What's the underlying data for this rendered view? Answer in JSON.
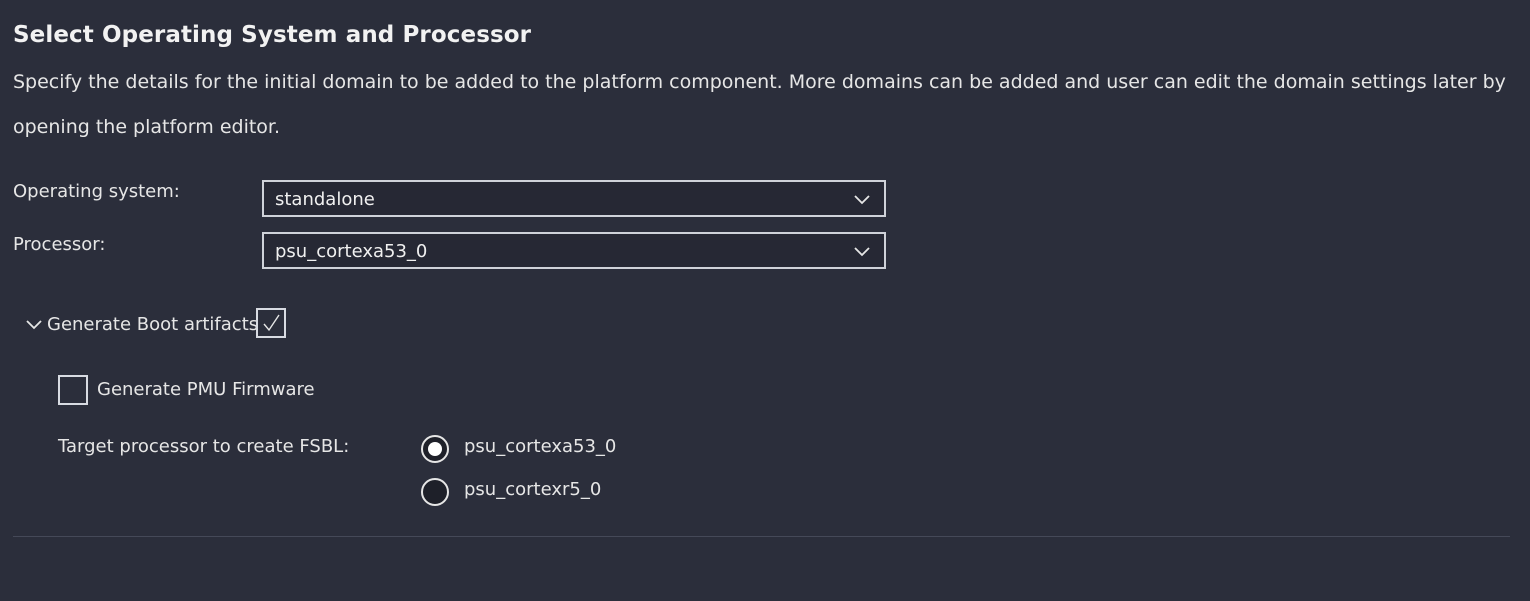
{
  "header": {
    "title": "Select Operating System and Processor",
    "description": "Specify the details for the initial domain to be added to the platform component. More domains can be added and user can edit the domain settings later by opening the platform editor."
  },
  "fields": {
    "os_label": "Operating system:",
    "os_value": "standalone",
    "processor_label": "Processor:",
    "processor_value": "psu_cortexa53_0"
  },
  "boot": {
    "section_label": "Generate Boot artifacts",
    "section_expanded": true,
    "generate_boot_checked": true,
    "pmu_label": "Generate PMU Firmware",
    "pmu_checked": false,
    "fsbl_label": "Target processor to create FSBL:",
    "fsbl_options": [
      {
        "label": "psu_cortexa53_0",
        "selected": true
      },
      {
        "label": "psu_cortexr5_0",
        "selected": false
      }
    ]
  },
  "icons": {
    "dropdown": "chevron-down-icon",
    "section": "chevron-down-icon",
    "check": "checkmark-icon"
  },
  "colors": {
    "background": "#2b2e3b",
    "text": "#e6e6e6",
    "input_border": "#cfd2d9"
  }
}
